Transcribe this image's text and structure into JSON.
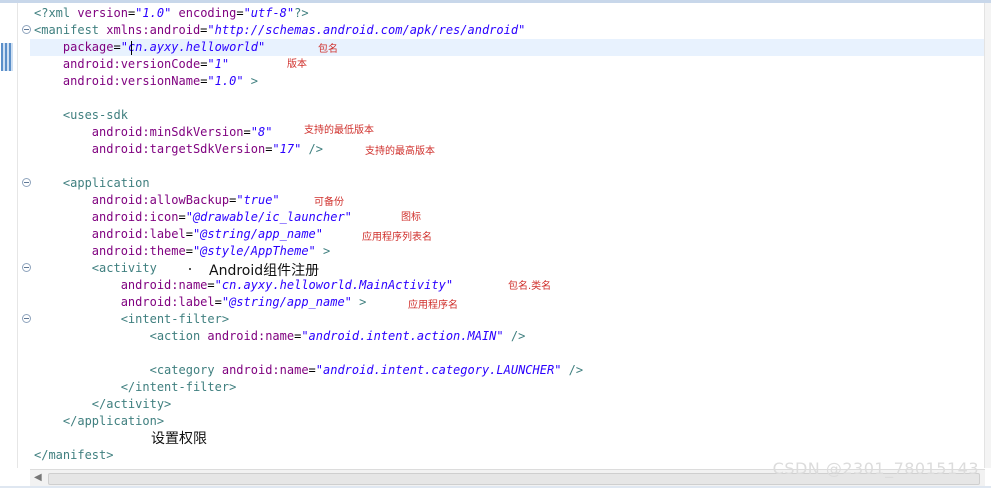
{
  "code_lines": [
    [
      {
        "t": "<?xml ",
        "c": "tag"
      },
      {
        "t": "version",
        "c": "attr"
      },
      {
        "t": "=",
        "c": "eq"
      },
      {
        "t": "\"1.0\"",
        "c": "val"
      },
      {
        "t": " ",
        "c": "eq"
      },
      {
        "t": "encoding",
        "c": "attr"
      },
      {
        "t": "=",
        "c": "eq"
      },
      {
        "t": "\"utf-8\"",
        "c": "val"
      },
      {
        "t": "?>",
        "c": "tag"
      }
    ],
    [
      {
        "t": "<manifest ",
        "c": "tag"
      },
      {
        "t": "xmlns:android",
        "c": "attr"
      },
      {
        "t": "=",
        "c": "eq"
      },
      {
        "t": "\"http://schemas.android.com/apk/res/android\"",
        "c": "val"
      }
    ],
    [
      {
        "t": "    ",
        "c": "eq"
      },
      {
        "t": "package",
        "c": "attr"
      },
      {
        "t": "=",
        "c": "eq"
      },
      {
        "t": "\"cn.ayxy.helloworld\"",
        "c": "val"
      }
    ],
    [
      {
        "t": "    ",
        "c": "eq"
      },
      {
        "t": "android:versionCode",
        "c": "attr"
      },
      {
        "t": "=",
        "c": "eq"
      },
      {
        "t": "\"1\"",
        "c": "val"
      }
    ],
    [
      {
        "t": "    ",
        "c": "eq"
      },
      {
        "t": "android:versionName",
        "c": "attr"
      },
      {
        "t": "=",
        "c": "eq"
      },
      {
        "t": "\"1.0\"",
        "c": "val"
      },
      {
        "t": " >",
        "c": "tag"
      }
    ],
    [],
    [
      {
        "t": "    <uses-sdk",
        "c": "tag"
      }
    ],
    [
      {
        "t": "        ",
        "c": "eq"
      },
      {
        "t": "android:minSdkVersion",
        "c": "attr"
      },
      {
        "t": "=",
        "c": "eq"
      },
      {
        "t": "\"8\"",
        "c": "val"
      }
    ],
    [
      {
        "t": "        ",
        "c": "eq"
      },
      {
        "t": "android:targetSdkVersion",
        "c": "attr"
      },
      {
        "t": "=",
        "c": "eq"
      },
      {
        "t": "\"17\"",
        "c": "val"
      },
      {
        "t": " />",
        "c": "tag"
      }
    ],
    [],
    [
      {
        "t": "    <application",
        "c": "tag"
      }
    ],
    [
      {
        "t": "        ",
        "c": "eq"
      },
      {
        "t": "android:allowBackup",
        "c": "attr"
      },
      {
        "t": "=",
        "c": "eq"
      },
      {
        "t": "\"true\"",
        "c": "val"
      }
    ],
    [
      {
        "t": "        ",
        "c": "eq"
      },
      {
        "t": "android:icon",
        "c": "attr"
      },
      {
        "t": "=",
        "c": "eq"
      },
      {
        "t": "\"@drawable/ic_launcher\"",
        "c": "val"
      }
    ],
    [
      {
        "t": "        ",
        "c": "eq"
      },
      {
        "t": "android:label",
        "c": "attr"
      },
      {
        "t": "=",
        "c": "eq"
      },
      {
        "t": "\"@string/app_name\"",
        "c": "val"
      }
    ],
    [
      {
        "t": "        ",
        "c": "eq"
      },
      {
        "t": "android:theme",
        "c": "attr"
      },
      {
        "t": "=",
        "c": "eq"
      },
      {
        "t": "\"@style/AppTheme\"",
        "c": "val"
      },
      {
        "t": " >",
        "c": "tag"
      }
    ],
    [
      {
        "t": "        <activity",
        "c": "tag"
      }
    ],
    [
      {
        "t": "            ",
        "c": "eq"
      },
      {
        "t": "android:name",
        "c": "attr"
      },
      {
        "t": "=",
        "c": "eq"
      },
      {
        "t": "\"cn.ayxy.helloworld.MainActivity\"",
        "c": "val"
      }
    ],
    [
      {
        "t": "            ",
        "c": "eq"
      },
      {
        "t": "android:label",
        "c": "attr"
      },
      {
        "t": "=",
        "c": "eq"
      },
      {
        "t": "\"@string/app_name\"",
        "c": "val"
      },
      {
        "t": " >",
        "c": "tag"
      }
    ],
    [
      {
        "t": "            <intent-filter>",
        "c": "tag"
      }
    ],
    [
      {
        "t": "                <action ",
        "c": "tag"
      },
      {
        "t": "android:name",
        "c": "attr"
      },
      {
        "t": "=",
        "c": "eq"
      },
      {
        "t": "\"android.intent.action.MAIN\"",
        "c": "val"
      },
      {
        "t": " />",
        "c": "tag"
      }
    ],
    [],
    [
      {
        "t": "                <category ",
        "c": "tag"
      },
      {
        "t": "android:name",
        "c": "attr"
      },
      {
        "t": "=",
        "c": "eq"
      },
      {
        "t": "\"android.intent.category.LAUNCHER\"",
        "c": "val"
      },
      {
        "t": " />",
        "c": "tag"
      }
    ],
    [
      {
        "t": "            </intent-filter>",
        "c": "tag"
      }
    ],
    [
      {
        "t": "        </activity>",
        "c": "tag"
      }
    ],
    [
      {
        "t": "    </application>",
        "c": "tag"
      }
    ],
    [],
    [
      {
        "t": "</manifest>",
        "c": "tag"
      }
    ]
  ],
  "annotations": {
    "package": "包名",
    "version": "版本",
    "min_sdk": "支持的最低版本",
    "target_sdk": "支持的最高版本",
    "allow_backup": "可备份",
    "icon": "图标",
    "label": "应用程序列表名",
    "activity_name": "包名.类名",
    "activity_label": "应用程序名"
  },
  "callouts": {
    "component_register": "Android组件注册",
    "permissions": "设置权限"
  },
  "watermark": "CSDN @2301_78015143",
  "colors": {
    "tag": "#3f7f7f",
    "attribute": "#7f007f",
    "value": "#2a00ff",
    "annotation": "#d0312d",
    "current_line": "#e8f2fe"
  }
}
